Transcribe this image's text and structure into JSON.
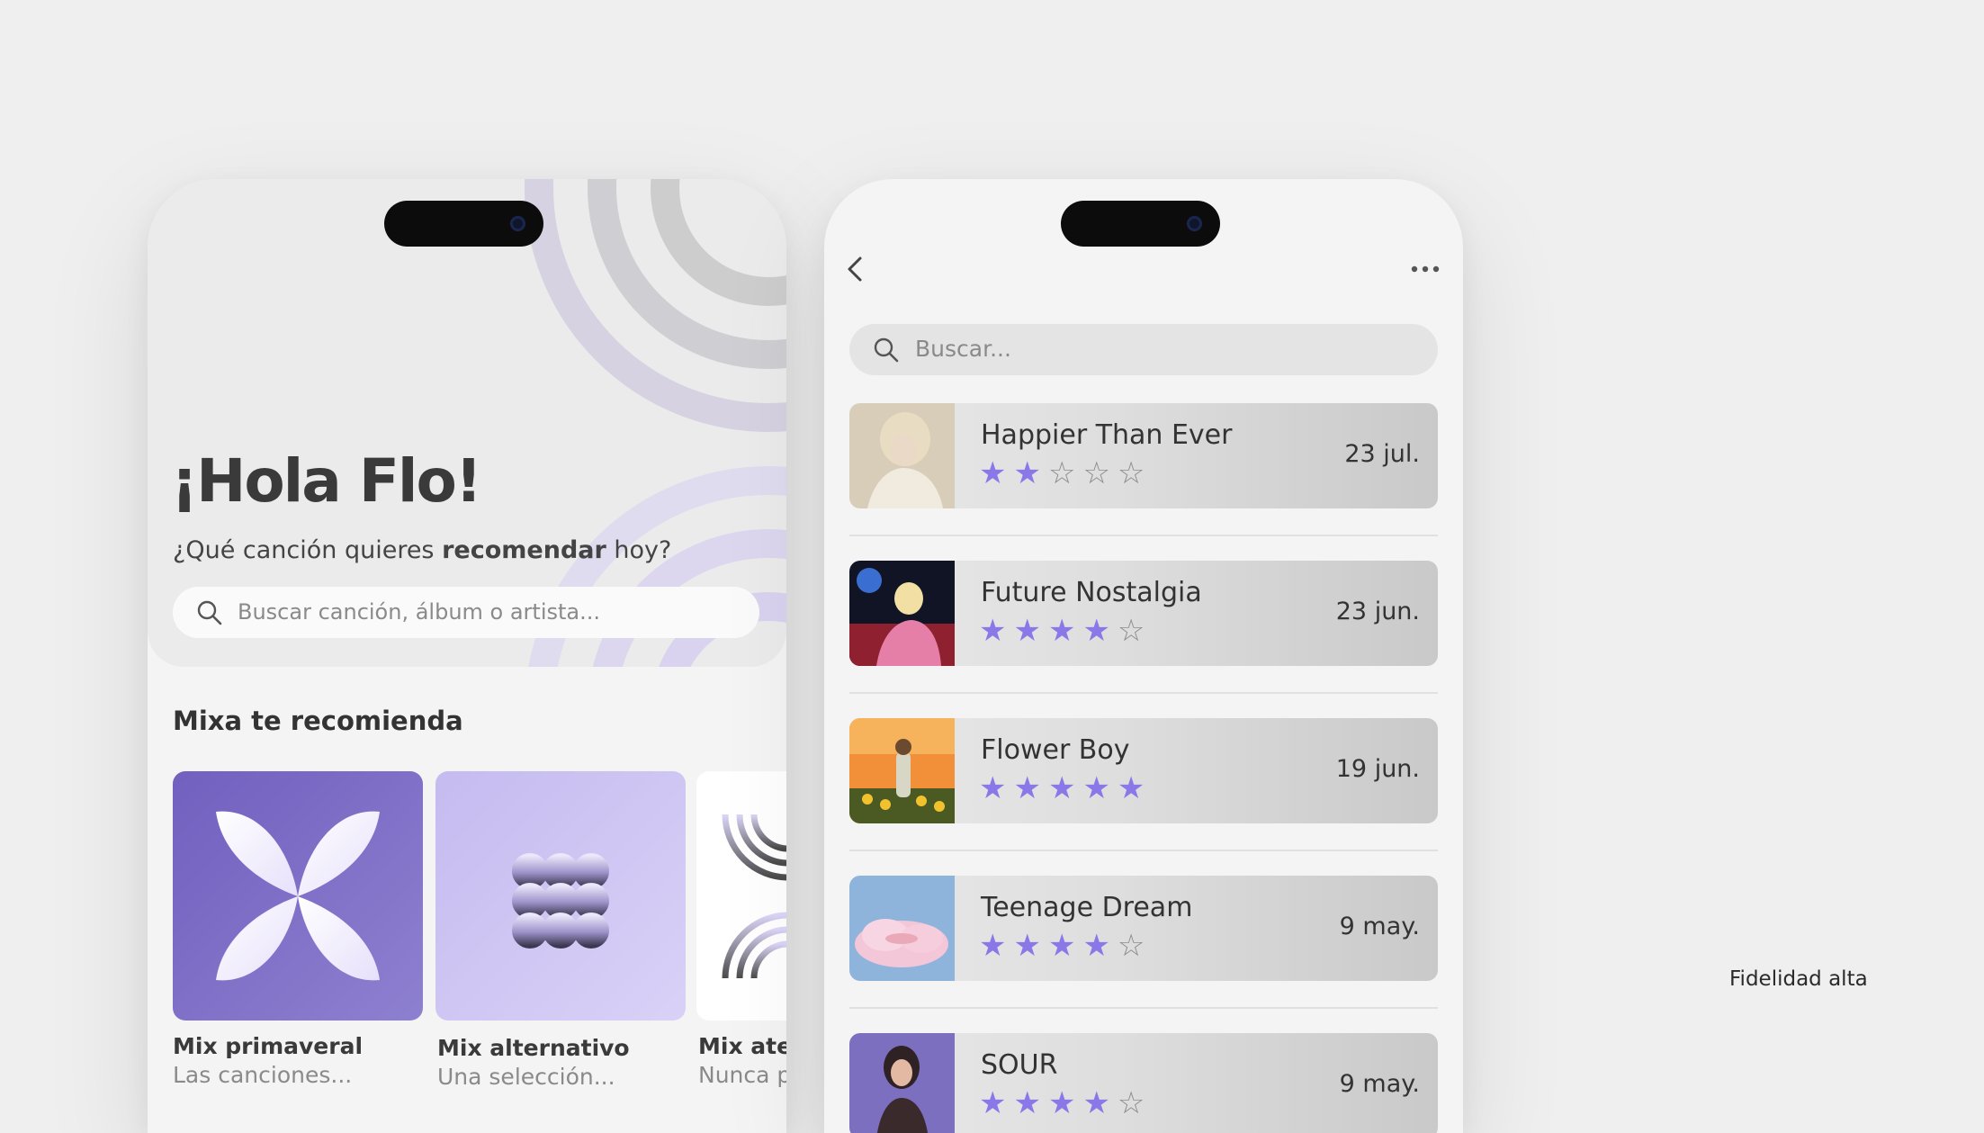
{
  "home": {
    "greeting": "¡Hola Flo!",
    "subtitle_prefix": "¿Qué canción quieres ",
    "subtitle_bold": "recomendar",
    "subtitle_suffix": " hoy?",
    "search_placeholder": "Buscar canción, álbum o artista...",
    "section_title": "Mixa te recomienda",
    "mixes": [
      {
        "title": "Mix primaveral",
        "subtitle": "Las canciones..."
      },
      {
        "title": "Mix alternativo",
        "subtitle": "Una selección..."
      },
      {
        "title": "Mix aten",
        "subtitle": "Nunca p"
      }
    ]
  },
  "list": {
    "search_placeholder": "Buscar...",
    "albums": [
      {
        "title": "Happier Than Ever",
        "rating": 2,
        "date": "23 jul."
      },
      {
        "title": "Future Nostalgia",
        "rating": 4,
        "date": "23 jun."
      },
      {
        "title": "Flower Boy",
        "rating": 5,
        "date": "19 jun."
      },
      {
        "title": "Teenage Dream",
        "rating": 4,
        "date": "9 may."
      },
      {
        "title": "SOUR",
        "rating": 4,
        "date": "9 may."
      }
    ]
  },
  "footnote": "Fidelidad alta",
  "colors": {
    "accent": "#8b78e8",
    "mix1": "#7260bf",
    "mix2": "#c5bbf0"
  },
  "icons": [
    "search-icon",
    "back-arrow-icon",
    "more-icon",
    "star-icon",
    "butterfly-icon",
    "grid-dots-icon",
    "arcs-icon"
  ]
}
